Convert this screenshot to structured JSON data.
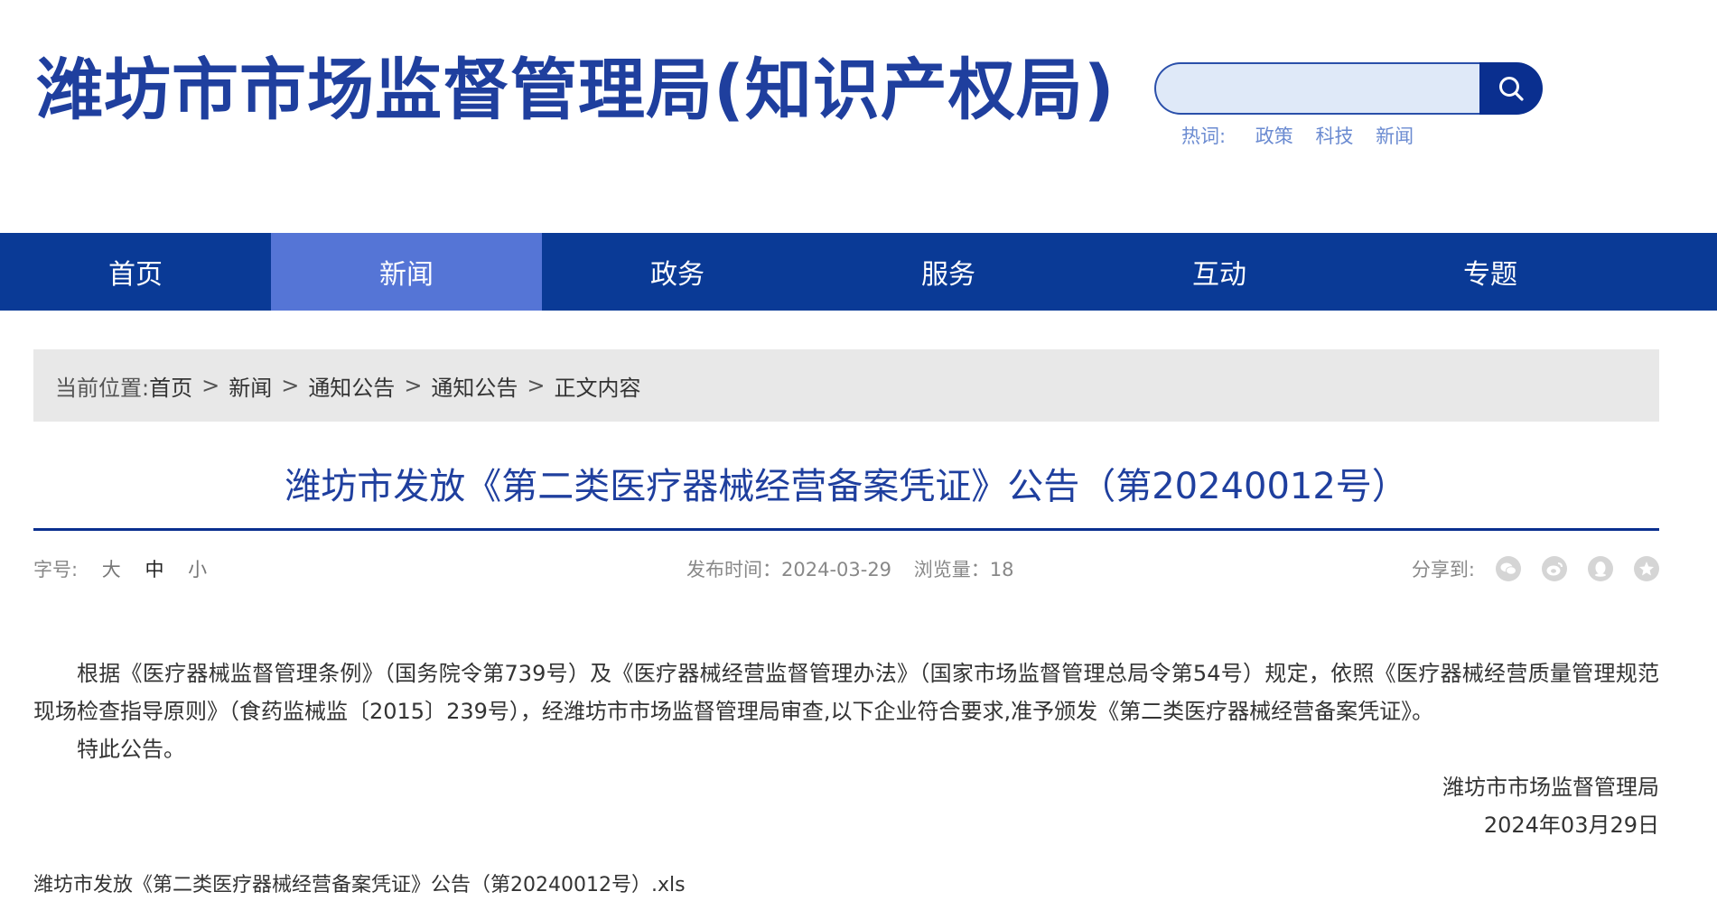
{
  "header": {
    "site_title": "潍坊市市场监督管理局(知识产权局)",
    "search": {
      "placeholder": ""
    },
    "hot_words": {
      "label": "热词:",
      "items": [
        "政策",
        "科技",
        "新闻"
      ]
    }
  },
  "nav": {
    "items": [
      "首页",
      "新闻",
      "政务",
      "服务",
      "互动",
      "专题"
    ],
    "active_index": 1
  },
  "breadcrumb": {
    "label": "当前位置:",
    "items": [
      "首页",
      "新闻",
      "通知公告",
      "通知公告",
      "正文内容"
    ],
    "separator": ">"
  },
  "article": {
    "title": "潍坊市发放《第二类医疗器械经营备案凭证》公告（第20240012号）",
    "font_size": {
      "label": "字号:",
      "large": "大",
      "medium": "中",
      "small": "小"
    },
    "publish": "发布时间：2024-03-29",
    "views": "浏览量：18",
    "share_label": "分享到:",
    "share_icons": [
      "wechat-icon",
      "weibo-icon",
      "qq-icon",
      "qzone-icon"
    ],
    "paragraphs": [
      "根据《医疗器械监督管理条例》（国务院令第739号）及《医疗器械经营监督管理办法》（国家市场监督管理总局令第54号）规定，依照《医疗器械经营质量管理规范现场检查指导原则》（食药监械监〔2015〕239号），经潍坊市市场监督管理局审查,以下企业符合要求,准予颁发《第二类医疗器械经营备案凭证》。",
      "特此公告。"
    ],
    "signature": "潍坊市市场监督管理局",
    "date": "2024年03月29日",
    "attachment": "潍坊市发放《第二类医疗器械经营备案凭证》公告（第20240012号）.xls"
  },
  "colors": {
    "brand": "#1f3f9e",
    "nav_bg": "#0a3a96",
    "nav_active": "#5575d6",
    "hot_words": "#6b8bd1",
    "breadcrumb_bg": "#e8e8e8"
  }
}
